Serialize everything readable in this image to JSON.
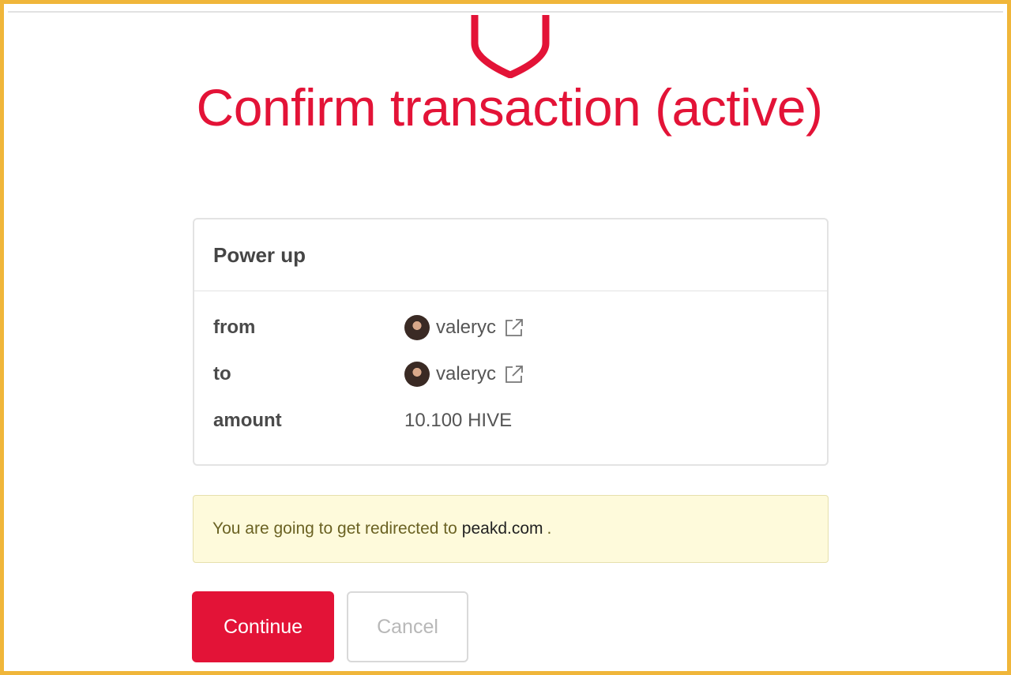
{
  "page": {
    "title": "Confirm transaction (active)",
    "logo_icon": "hive-keychain-shield-icon",
    "accent_color": "#e31337",
    "frame_color": "#f0b63a"
  },
  "operation": {
    "title": "Power up",
    "rows": [
      {
        "label": "from",
        "value": "valeryc",
        "icon": "external-link-icon"
      },
      {
        "label": "to",
        "value": "valeryc",
        "icon": "external-link-icon"
      },
      {
        "label": "amount",
        "value": "10.100 HIVE"
      }
    ]
  },
  "notice": {
    "text": "You are going to get redirected to",
    "domain": "peakd.com",
    "suffix": ".",
    "background": "#fefadb"
  },
  "actions": {
    "continue_label": "Continue",
    "cancel_label": "Cancel"
  }
}
